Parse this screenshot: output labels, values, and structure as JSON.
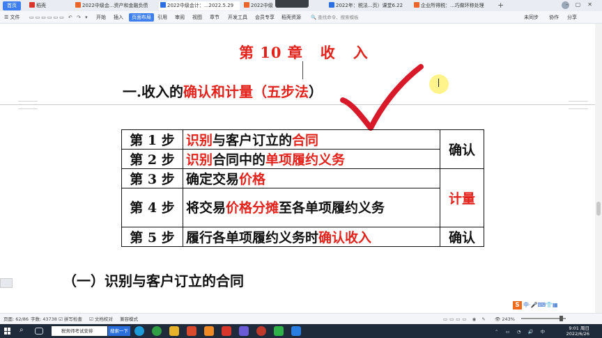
{
  "tabs": [
    {
      "label": "首页",
      "kind": "home"
    },
    {
      "label": "稻壳",
      "kind": "docer"
    },
    {
      "label": "2022中级会...资产和金融负债",
      "kind": "ppt"
    },
    {
      "label": "2022中级会计：...2022.5.29",
      "kind": "word"
    },
    {
      "label": "2022中级财",
      "kind": "ppt"
    },
    {
      "label": "2022年：税法...页）课堂6.22",
      "kind": "word"
    },
    {
      "label": "企业所得税：...巧做环称处理",
      "kind": "ppt"
    }
  ],
  "window_controls": {
    "sync": "未同步",
    "collab": "协作",
    "share": "分享"
  },
  "ribbon": {
    "file": "文件",
    "items": [
      "开始",
      "插入",
      "页面布局",
      "引用",
      "审阅",
      "视图",
      "章节",
      "开发工具",
      "会员专享",
      "稻壳资源"
    ],
    "active": "页面布局",
    "search_placeholder": "查找命令、搜索模板"
  },
  "document": {
    "chapter_title": "第 10 章   收   入",
    "heading_prefix": "一.收入的",
    "heading_red": "确认和计量（五步法",
    "heading_suffix": "）",
    "table": {
      "rows": [
        {
          "step": "第 1 步",
          "parts": [
            {
              "t": "识别",
              "s": "r"
            },
            {
              "t": "与客户订立的",
              "s": "b"
            },
            {
              "t": "合同",
              "s": "r"
            }
          ]
        },
        {
          "step": "第 2 步",
          "parts": [
            {
              "t": "识别",
              "s": "r"
            },
            {
              "t": "合同中的",
              "s": "b"
            },
            {
              "t": "单项履约义务",
              "s": "r"
            }
          ]
        },
        {
          "step": "第 3 步",
          "parts": [
            {
              "t": "确定交易",
              "s": "b"
            },
            {
              "t": "价格",
              "s": "r"
            }
          ]
        },
        {
          "step": "第 4 步",
          "parts": [
            {
              "t": "将交易",
              "s": "b"
            },
            {
              "t": "价格分摊",
              "s": "r"
            },
            {
              "t": "至各单项履约义务",
              "s": "b"
            }
          ]
        },
        {
          "step": "第 5 步",
          "parts": [
            {
              "t": "履行各单项履约义务时",
              "s": "b"
            },
            {
              "t": "确认收入",
              "s": "r"
            }
          ]
        }
      ],
      "stage_confirm": "确认",
      "stage_measure": "计量",
      "stage_confirm_2": "确认"
    },
    "subheading": "（一）识别与客户订立的合同"
  },
  "statusbar": {
    "page": "页面: 62/86",
    "words": "字数: 43738",
    "spellcheck": "拼写检查",
    "proofread": "文档校对",
    "compat": "兼容模式",
    "zoom": "243%"
  },
  "taskbar": {
    "search_text": "税务师考试安排",
    "search_button": "搜索一下",
    "time": "9:01 周日",
    "date": "2022/6/26"
  },
  "colors": {
    "accent": "#3d7ff0",
    "title_red": "#e2221b",
    "check_red": "#d8192a"
  }
}
